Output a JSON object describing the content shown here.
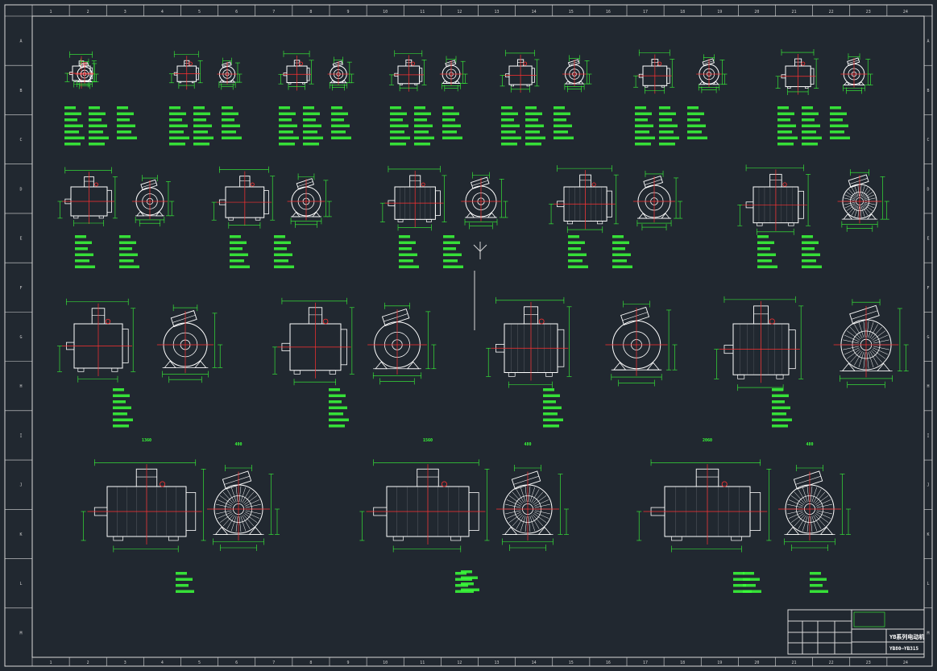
{
  "colors": {
    "background": "#212830",
    "frame": "#d9d9d9",
    "geometry": "#ffffff",
    "dimension": "#39ff39",
    "centerline": "#ff3030",
    "grid_text": "#cfcfcf"
  },
  "border": {
    "top_columns": [
      "1",
      "2",
      "3",
      "4",
      "5",
      "6",
      "7",
      "8",
      "9",
      "10",
      "11",
      "12",
      "13",
      "14",
      "15",
      "16",
      "17",
      "18",
      "19",
      "20",
      "21",
      "22",
      "23",
      "24"
    ],
    "rows": [
      "A",
      "B",
      "C",
      "D",
      "E",
      "F",
      "G",
      "H",
      "I",
      "J",
      "K",
      "L",
      "M"
    ]
  },
  "title_block": {
    "title": "YB系列电动机",
    "drawing_no": "YB80—YB315"
  },
  "rows": {
    "row1": [
      "YB80-2",
      "YB90-2",
      "YB100-2",
      "YB112-2",
      "YB132-2",
      "YB160-2",
      "YB180-2"
    ],
    "row2": [
      "YB200-2",
      "YB225-2",
      "YB250-2",
      "YB280-2",
      "YB315-2"
    ],
    "row3": [
      "YB355-4",
      "YB400-4",
      "YB450-4",
      "YB500-4"
    ],
    "row4": [
      "YB560-4",
      "YB630-4",
      "YB710-4"
    ]
  },
  "dimensions": {
    "row4_lengths": [
      "1360",
      "1560",
      "2060"
    ],
    "row4_widths": [
      "400",
      "480",
      "480"
    ]
  }
}
